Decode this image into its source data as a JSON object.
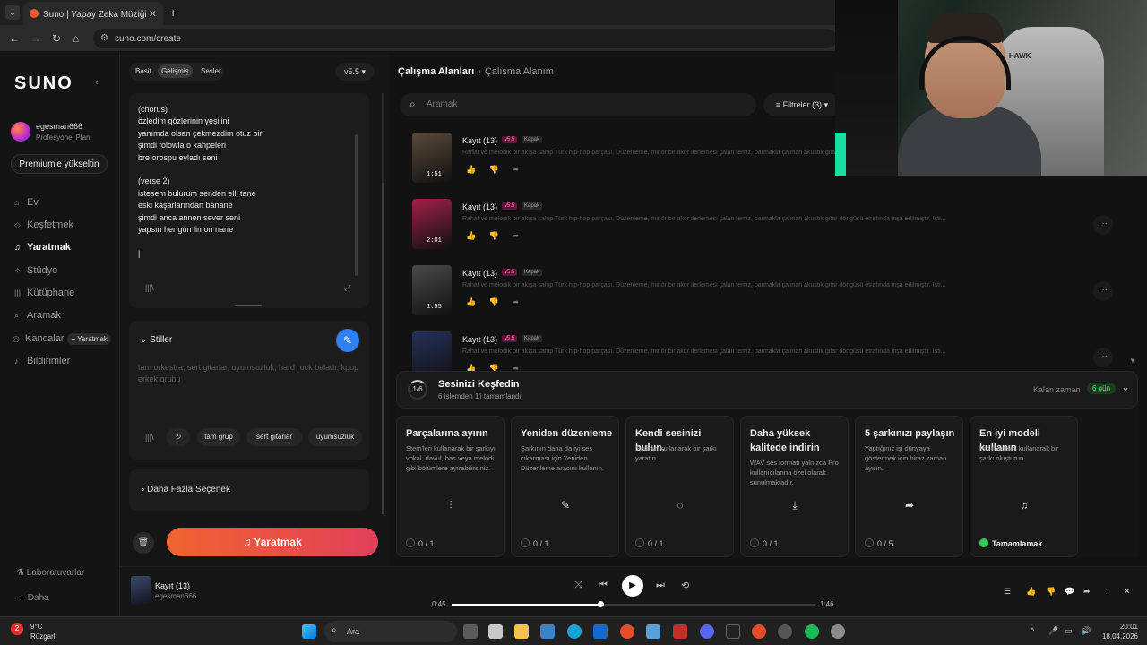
{
  "browser": {
    "tab_title": "Suno | Yapay Zeka Müziği",
    "tab_close": "✕",
    "new_tab": "+",
    "url": "suno.com/create"
  },
  "sidebar": {
    "logo": "SUNO",
    "user_name": "egesman666",
    "user_plan": "Profesyonel Plan",
    "premium_button": "Premium'e yükseltin",
    "nav": [
      {
        "label": "Ev",
        "icon": "home-icon"
      },
      {
        "label": "Keşfetmek",
        "icon": "explore-icon"
      },
      {
        "label": "Yaratmak",
        "icon": "music-note-icon"
      },
      {
        "label": "Stüdyo",
        "icon": "studio-icon"
      },
      {
        "label": "Kütüphane",
        "icon": "library-icon"
      },
      {
        "label": "Aramak",
        "icon": "search-icon"
      },
      {
        "label": "Kancalar",
        "icon": "hooks-icon",
        "badge": "+ Yaratmak"
      },
      {
        "label": "Bildirimler",
        "icon": "bell-icon"
      }
    ],
    "bottom": [
      {
        "label": "Laboratuvarlar"
      },
      {
        "label": "Daha"
      }
    ]
  },
  "create_panel": {
    "modes": [
      "Basit",
      "Gelişmiş",
      "Sesler"
    ],
    "active_mode": "Gelişmiş",
    "version": "v5.5",
    "lyrics": "(chorus)\nözledim gözlerinin yeşilini\nyanımda olsan çekmezdim otuz biri\nşimdi folowla o kahpeleri\nbre orospu evladı seni\n\n(verse 2)\nistesem bulurum senden elli tane\neski kaşarlarından banane\nşimdi anca annen sever seni\nyapsın her gün limon nane\n\n|",
    "styles_label": "Stiller",
    "styles_placeholder": "tam orkestra, sert gitarlar, uyumsuzluk, hard rock baladı, kpop erkek grubu",
    "style_chips": [
      "tam grup",
      "sert gitarlar",
      "uyumsuzluk"
    ],
    "more_options": "Daha Fazla Seçenek",
    "create_button": "Yaratmak"
  },
  "workspace": {
    "breadcrumb_root": "Çalışma Alanları",
    "breadcrumb_current": "Çalışma Alanım",
    "search_placeholder": "Aramak",
    "filters_label": "Filtreler",
    "filters_count": "(3)",
    "songs": [
      {
        "title": "Kayıt (13)",
        "version": "v5.5",
        "tag": "Kapak",
        "duration": "1:51",
        "desc": "Rahat ve melodik bir akışa sahip Türk hip-hop parçası. Düzenleme, minör bir akor ilerlemesi çalan temiz, parmakla çalınan akustik gitar döngüsü etrafında inşa edilmiştir. İsti...",
        "thumb_color": "#5a4a3a"
      },
      {
        "title": "Kayıt (13)",
        "version": "v5.5",
        "tag": "Kapak",
        "duration": "2:01",
        "desc": "Rahat ve melodik bir akışa sahip Türk hip-hop parçası. Düzenleme, minör bir akor ilerlemesi çalan temiz, parmakla çalınan akustik gitar döngüsü etrafında inşa edilmiştir. İsti...",
        "thumb_color": "#a0204a"
      },
      {
        "title": "Kayıt (13)",
        "version": "v5.5",
        "tag": "Kapak",
        "duration": "1:55",
        "desc": "Rahat ve melodik bir akışa sahip Türk hip-hop parçası. Düzenleme, minör bir akor ilerlemesi çalan temiz, parmakla çalınan akustik gitar döngüsü etrafında inşa edilmiştir. İsti...",
        "thumb_color": "#4a4a4a"
      },
      {
        "title": "Kayıt (13)",
        "version": "v5.5",
        "tag": "Kapak",
        "duration": "",
        "desc": "Rahat ve melodik bir akışa sahip Türk hip-hop parçası. Düzenleme, minör bir akor ilerlemesi çalan temiz, parmakla çalınan akustik gitar döngüsü etrafında inşa edilmiştir. İsti...",
        "thumb_color": "#23305a"
      }
    ]
  },
  "discover": {
    "progress": "1/6",
    "title": "Sesinizi Keşfedin",
    "subtitle": "6 işlemden 1'i tamamlandı",
    "remaining_label": "Kalan zaman",
    "remaining_value": "6 gün",
    "cards": [
      {
        "title": "Parçalarına ayırın",
        "desc": "Stem'leri kullanarak bir şarkıyı vokal, davul, bas veya melodi gibi bölümlere ayırabilirsiniz.",
        "icon": "waveform-icon",
        "status": "0 / 1",
        "done": false
      },
      {
        "title": "Yeniden düzenleme",
        "desc": "Şarkının daha da iyi ses çıkarması için Yeniden Düzenleme aracını kullanın.",
        "icon": "magic-wand-icon",
        "status": "0 / 1",
        "done": false
      },
      {
        "title": "Kendi sesinizi bulun.",
        "desc": "Sesinizi kullanarak bir şarkı yaratın.",
        "icon": "voice-scan-icon",
        "status": "0 / 1",
        "done": false
      },
      {
        "title": "Daha yüksek kalitede indirin",
        "desc": "WAV ses formatı yalnızca Pro kullanıcılarına özel olarak sunulmaktadır.",
        "icon": "download-icon",
        "status": "0 / 1",
        "done": false
      },
      {
        "title": "5 şarkınızı paylaşın",
        "desc": "Yaptığınız işi dünyaya göstermek için biraz zaman ayırın.",
        "icon": "share-icon",
        "status": "0 / 5",
        "done": false
      },
      {
        "title": "En iyi modeli kullanın",
        "desc": "Pro modelini kullanarak bir şarkı oluşturun",
        "icon": "music-note-icon",
        "status": "Tamamlamak",
        "done": true
      }
    ]
  },
  "player": {
    "title": "Kayıt (13)",
    "artist": "egesman666",
    "current_time": "0:45",
    "total_time": "1:46",
    "progress": 0.41
  },
  "taskbar": {
    "temperature": "9°C",
    "weather": "Rüzgarlı",
    "weather_badge": "2",
    "search": "Ara",
    "time": "20:01",
    "date": "18.04.2026"
  },
  "webcam": {
    "brand": "HAWK"
  }
}
